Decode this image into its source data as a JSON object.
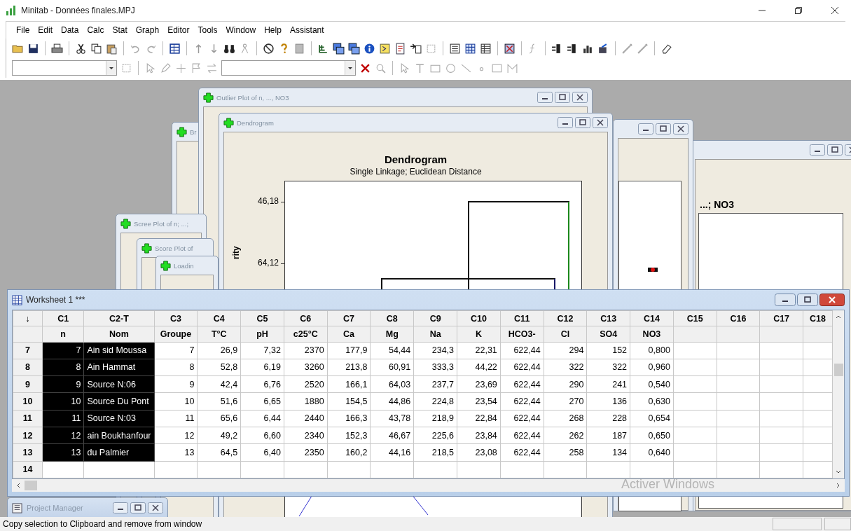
{
  "window": {
    "title": "Minitab - Données finales.MPJ"
  },
  "menu": [
    "File",
    "Edit",
    "Data",
    "Calc",
    "Stat",
    "Graph",
    "Editor",
    "Tools",
    "Window",
    "Help",
    "Assistant"
  ],
  "graph_windows": [
    {
      "kind": "titled",
      "title": "Br"
    },
    {
      "kind": "titled",
      "title": "Outlier Plot of n, ..., NO3",
      "controls": true
    },
    {
      "kind": "plot",
      "plot_title": "...; NO3",
      "controls": true
    },
    {
      "kind": "marker",
      "controls": true
    },
    {
      "kind": "dendrogram",
      "title": "Dendrogram",
      "chart_title": "Dendrogram",
      "subtitle": "Single Linkage; Euclidean Distance",
      "y_ticks": [
        "46,18",
        "64,12"
      ],
      "y_label": "rity",
      "controls": true
    },
    {
      "kind": "titled",
      "title": "Scree Plot of n; ...;"
    },
    {
      "kind": "titled",
      "title": "Score Plot of"
    },
    {
      "kind": "titled",
      "title": "Loadin"
    }
  ],
  "worksheet": {
    "title": "Worksheet 1 ***",
    "corner": "↓",
    "columns": [
      {
        "id": "C1",
        "name": "n",
        "kind": "number",
        "selected": true
      },
      {
        "id": "C2-T",
        "name": "Nom",
        "kind": "text",
        "selected": true
      },
      {
        "id": "C3",
        "name": "Groupe",
        "kind": "number",
        "selected": false
      },
      {
        "id": "C4",
        "name": "T°C",
        "kind": "number",
        "selected": false
      },
      {
        "id": "C5",
        "name": "pH",
        "kind": "number",
        "selected": false
      },
      {
        "id": "C6",
        "name": "c25°C",
        "kind": "number",
        "selected": false
      },
      {
        "id": "C7",
        "name": "Ca",
        "kind": "number",
        "selected": false
      },
      {
        "id": "C8",
        "name": "Mg",
        "kind": "number",
        "selected": false
      },
      {
        "id": "C9",
        "name": "Na",
        "kind": "number",
        "selected": false
      },
      {
        "id": "C10",
        "name": "K",
        "kind": "number",
        "selected": false
      },
      {
        "id": "C11",
        "name": "HCO3-",
        "kind": "number",
        "selected": false
      },
      {
        "id": "C12",
        "name": "Cl",
        "kind": "number",
        "selected": false
      },
      {
        "id": "C13",
        "name": "SO4",
        "kind": "number",
        "selected": false
      },
      {
        "id": "C14",
        "name": "NO3",
        "kind": "number",
        "selected": false
      },
      {
        "id": "C15",
        "kind": "number",
        "selected": false
      },
      {
        "id": "C16",
        "kind": "number",
        "selected": false
      },
      {
        "id": "C17",
        "kind": "number",
        "selected": false
      },
      {
        "id": "C18",
        "kind": "number",
        "selected": false
      }
    ],
    "rows": [
      {
        "label": "7",
        "selected": true,
        "cells": [
          "7",
          "Ain sid Moussa",
          "7",
          "26,9",
          "7,32",
          "2370",
          "177,9",
          "54,44",
          "234,3",
          "22,31",
          "622,44",
          "294",
          "152",
          "0,800"
        ]
      },
      {
        "label": "8",
        "selected": true,
        "cells": [
          "8",
          "Ain Hammat",
          "8",
          "52,8",
          "6,19",
          "3260",
          "213,8",
          "60,91",
          "333,3",
          "44,22",
          "622,44",
          "322",
          "322",
          "0,960"
        ]
      },
      {
        "label": "9",
        "selected": true,
        "cells": [
          "9",
          "Source N:06",
          "9",
          "42,4",
          "6,76",
          "2520",
          "166,1",
          "64,03",
          "237,7",
          "23,69",
          "622,44",
          "290",
          "241",
          "0,540"
        ]
      },
      {
        "label": "10",
        "selected": true,
        "cells": [
          "10",
          "Source Du Pont",
          "10",
          "51,6",
          "6,65",
          "1880",
          "154,5",
          "44,86",
          "224,8",
          "23,54",
          "622,44",
          "270",
          "136",
          "0,630"
        ]
      },
      {
        "label": "11",
        "selected": true,
        "cells": [
          "11",
          "Source N:03",
          "11",
          "65,6",
          "6,44",
          "2440",
          "166,3",
          "43,78",
          "218,9",
          "22,84",
          "622,44",
          "268",
          "228",
          "0,654"
        ]
      },
      {
        "label": "12",
        "selected": true,
        "cells": [
          "12",
          "ain Boukhanfour",
          "12",
          "49,2",
          "6,60",
          "2340",
          "152,3",
          "46,67",
          "225,6",
          "23,84",
          "622,44",
          "262",
          "187",
          "0,650"
        ]
      },
      {
        "label": "13",
        "selected": true,
        "cells": [
          "13",
          "du Palmier",
          "13",
          "64,5",
          "6,40",
          "2350",
          "160,2",
          "44,16",
          "218,5",
          "23,08",
          "622,44",
          "258",
          "134",
          "0,640"
        ]
      },
      {
        "label": "14",
        "selected": false
      }
    ]
  },
  "os_notice": "Activer Windows",
  "project_manager": {
    "title": "Project Manager"
  },
  "status_bar": {
    "message": "Copy selection to Clipboard and remove from window"
  }
}
